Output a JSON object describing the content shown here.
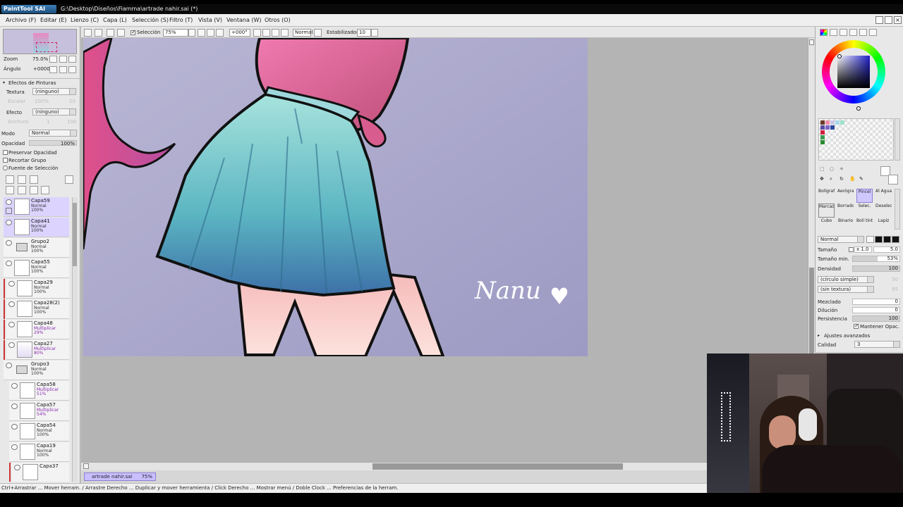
{
  "app": {
    "logo_text": "PaintTool SAI",
    "window_title": "G:\\Desktop\\Diseños\\Fiamma\\artrade nahir.sai (*)"
  },
  "menu": [
    "Archivo (F)",
    "Editar (E)",
    "Lienzo (C)",
    "Capa (L)",
    "Selección (S)",
    "Filtro (T)",
    "Vista (V)",
    "Ventana (W)",
    "Otros (O)"
  ],
  "toolbar": {
    "selection_label": "Selección",
    "zoom": "75%",
    "angle": "+000°",
    "blend_mode": "Normal",
    "stabilizer_label": "Estabilizador",
    "stabilizer_value": "10"
  },
  "navigator": {
    "zoom_label": "Zoom",
    "zoom_value": "75.0%",
    "angle_label": "Ángulo",
    "angle_value": "+0000"
  },
  "paint_effects": {
    "header": "Efectos de Pinturas",
    "texture_label": "Textura",
    "texture_value": "(ninguno)",
    "effect_label": "Efecto",
    "effect_value": "(ninguno)",
    "escalar_label": "Escalar",
    "escalar_value": "100%",
    "escalar_num": "20",
    "anchura_label": "Anchura",
    "anchura_value": "1",
    "anchura_num": "100"
  },
  "layer_props": {
    "mode_label": "Modo",
    "mode_value": "Normal",
    "opacity_label": "Opacidad",
    "opacity_value": "100%",
    "preserve_opacity": "Preservar Opacidad",
    "clip_group": "Recortar Grupo",
    "selection_source": "Fuente de Selección"
  },
  "layers": [
    {
      "name": "Capa59",
      "mode": "Normal",
      "opacity": "100%",
      "active": true
    },
    {
      "name": "Capa41",
      "mode": "Normal",
      "opacity": "100%",
      "active": true
    },
    {
      "name": "Grupo2",
      "mode": "Normal",
      "opacity": "100%",
      "folder": true
    },
    {
      "name": "Capa55",
      "mode": "Normal",
      "opacity": "100%"
    },
    {
      "name": "Capa29",
      "mode": "Normal",
      "opacity": "100%",
      "clipped": true
    },
    {
      "name": "Capa28(2)",
      "mode": "Normal",
      "opacity": "100%",
      "clipped": true
    },
    {
      "name": "Capa48",
      "mode": "Multiplicar",
      "opacity": "29%",
      "clipped": true
    },
    {
      "name": "Capa27",
      "mode": "Multiplicar",
      "opacity": "80%",
      "clipped": true
    },
    {
      "name": "Grupo3",
      "mode": "Normal",
      "opacity": "100%",
      "folder": true
    },
    {
      "name": "Capa58",
      "mode": "Multiplicar",
      "opacity": "51%",
      "indent": true
    },
    {
      "name": "Capa57",
      "mode": "Multiplicar",
      "opacity": "54%",
      "indent": true
    },
    {
      "name": "Capa54",
      "mode": "Normal",
      "opacity": "100%",
      "indent": true
    },
    {
      "name": "Capa19",
      "mode": "Normal",
      "opacity": "100%",
      "indent": true
    },
    {
      "name": "Capa37",
      "mode": "",
      "opacity": "",
      "indent": true,
      "clipped": true
    }
  ],
  "document_tab": {
    "name": "artrade nahir.sai",
    "zoom": "75%"
  },
  "canvas": {
    "signature": "Nanu"
  },
  "statusbar": "Ctrl+Arrastrar ... Mover herram. / Arrastre Derecho ... Duplicar y mover herramienta / Click Derecho ... Mostrar menú / Doble Clock ... Preferencias de la herram.",
  "brushes": {
    "row1": [
      "Bolígrafo",
      "Aerógrafo",
      "Pincel",
      "Al Agua"
    ],
    "row2": [
      "Marcador",
      "Borrador",
      "Selec.",
      "Deselec."
    ],
    "row3": [
      "Cubo",
      "Binario",
      "Boli tinta",
      "Lapiz"
    ]
  },
  "brush_settings": {
    "mode": "Normal",
    "size_label": "Tamaño",
    "size_mult": "x 1.0",
    "size_value": "5.0",
    "min_size_label": "Tamaño min.",
    "min_size_value": "53%",
    "density_label": "Densidad",
    "density_value": "100",
    "shape": "(círculo simple)",
    "texture": "(sin textura)",
    "shape_value": "50",
    "texture_value": "95",
    "blend_label": "Mezclado",
    "blend_value": "0",
    "dilution_label": "Dilución",
    "dilution_value": "0",
    "persistence_label": "Persistencia",
    "persistence_value": "100",
    "keep_opacity": "Mantener Opac.",
    "advanced": "Ajustes avanzados",
    "quality_label": "Calidad",
    "quality_value": "3"
  },
  "colors": {
    "accent": "#c9bfff",
    "primary": "#1e1e8c",
    "secondary": "#ffffff"
  }
}
